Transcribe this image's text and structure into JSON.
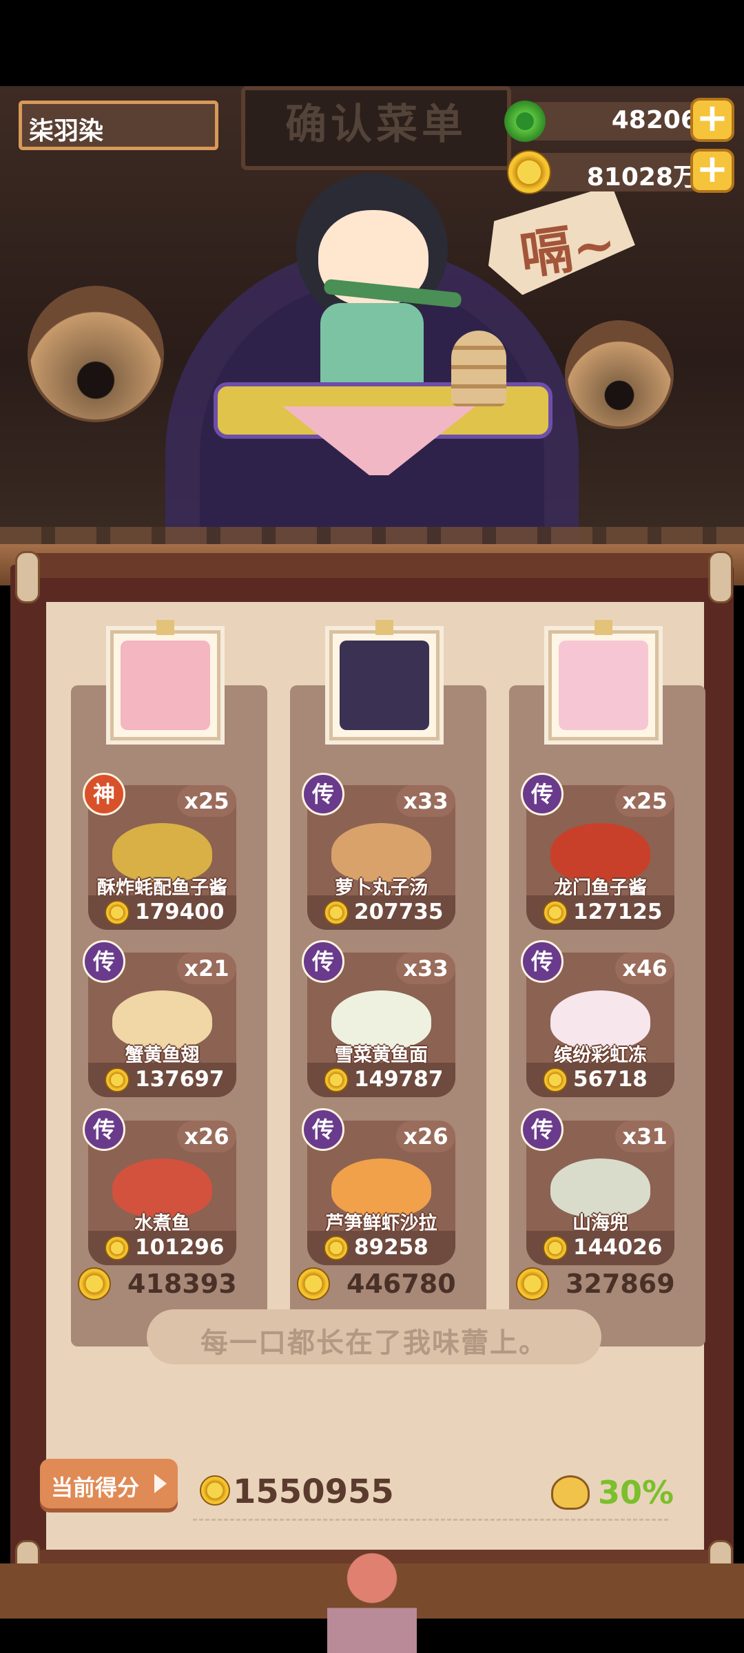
{
  "player": {
    "name": "柒羽染"
  },
  "resources": {
    "jade": "48206",
    "coins": "81028万",
    "plus": "+"
  },
  "scene": {
    "sign": "确认菜单",
    "bubble": "嗝~"
  },
  "columns": [
    {
      "total": "418393",
      "dishes": [
        {
          "rank": "神",
          "rank_color": "#d9512b",
          "qty": "x25",
          "name": "酥炸蚝配鱼子酱",
          "price": "179400",
          "food_color": "#d8b045"
        },
        {
          "rank": "传",
          "rank_color": "#6a3b8c",
          "qty": "x21",
          "name": "蟹黄鱼翅",
          "price": "137697",
          "food_color": "#f1d6a6"
        },
        {
          "rank": "传",
          "rank_color": "#6a3b8c",
          "qty": "x26",
          "name": "水煮鱼",
          "price": "101296",
          "food_color": "#d2523e"
        }
      ]
    },
    {
      "total": "446780",
      "dishes": [
        {
          "rank": "传",
          "rank_color": "#6a3b8c",
          "qty": "x33",
          "name": "萝卜丸子汤",
          "price": "207735",
          "food_color": "#d9a26b"
        },
        {
          "rank": "传",
          "rank_color": "#6a3b8c",
          "qty": "x33",
          "name": "雪菜黄鱼面",
          "price": "149787",
          "food_color": "#eef1e0"
        },
        {
          "rank": "传",
          "rank_color": "#6a3b8c",
          "qty": "x26",
          "name": "芦笋鲜虾沙拉",
          "price": "89258",
          "food_color": "#f0a14a"
        }
      ]
    },
    {
      "total": "327869",
      "dishes": [
        {
          "rank": "传",
          "rank_color": "#6a3b8c",
          "qty": "x25",
          "name": "龙门鱼子酱",
          "price": "127125",
          "food_color": "#c8402a"
        },
        {
          "rank": "传",
          "rank_color": "#6a3b8c",
          "qty": "x46",
          "name": "缤纷彩虹冻",
          "price": "56718",
          "food_color": "#f7e6ec"
        },
        {
          "rank": "传",
          "rank_color": "#6a3b8c",
          "qty": "x31",
          "name": "山海兜",
          "price": "144026",
          "food_color": "#d9dccb"
        }
      ]
    }
  ],
  "quote": "每一口都长在了我味蕾上。",
  "score": {
    "label": "当前得分",
    "value": "1550955",
    "percent": "30%"
  },
  "colors": {
    "portrait_1": "#f4b6c0",
    "portrait_2": "#3b3152",
    "portrait_3": "#f7c6d4"
  }
}
